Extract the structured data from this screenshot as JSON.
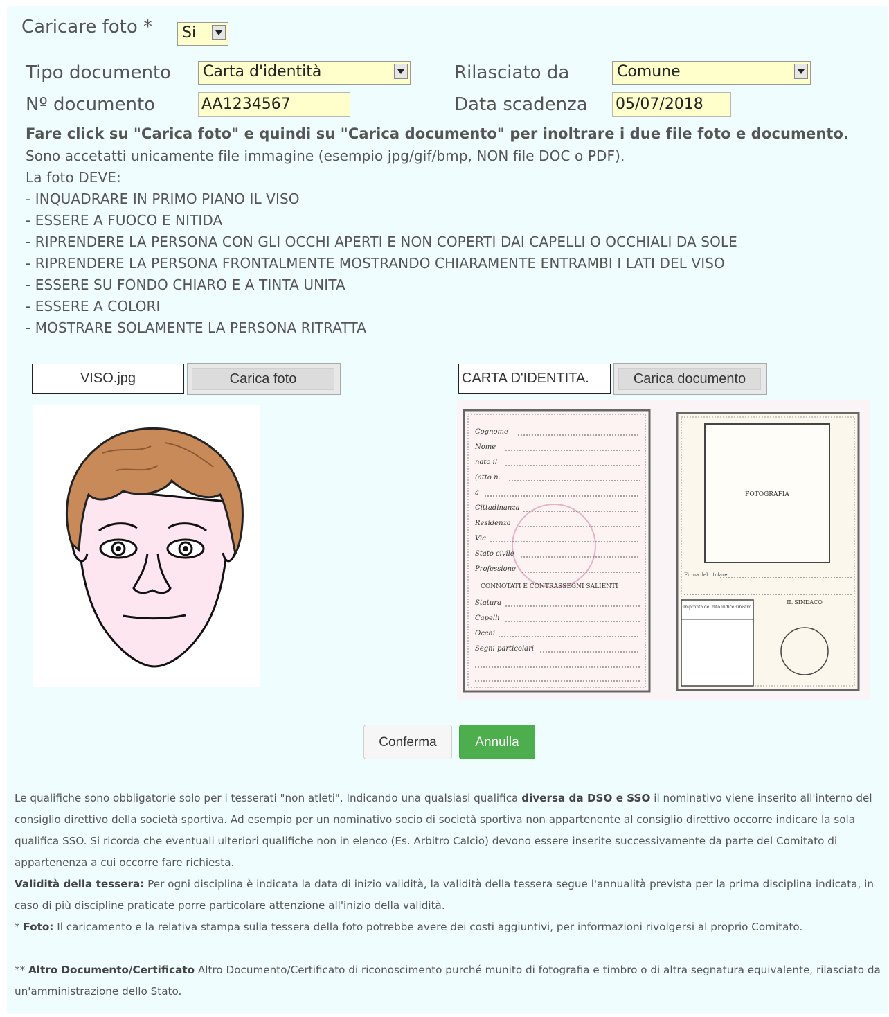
{
  "form": {
    "upload_photo_label": "Caricare foto *",
    "upload_photo_value": "Si",
    "doc_type_label": "Tipo documento",
    "doc_type_value": "Carta d'identità",
    "issued_by_label": "Rilasciato da",
    "issued_by_value": "Comune",
    "doc_number_label": "Nº documento",
    "doc_number_value": "AA1234567",
    "expiry_label": "Data scadenza",
    "expiry_value": "05/07/2018"
  },
  "instructions": {
    "bold_line": "Fare click su \"Carica foto\" e quindi su \"Carica documento\" per inoltrare i due file foto e documento.",
    "lines": [
      "Sono accetatti unicamente file immagine (esempio jpg/gif/bmp, NON file DOC o PDF).",
      "La foto DEVE:",
      "- INQUADRARE IN PRIMO PIANO IL VISO",
      "- ESSERE A FUOCO E NITIDA",
      "- RIPRENDERE LA PERSONA CON GLI OCCHI APERTI E NON COPERTI DAI CAPELLI O OCCHIALI DA SOLE",
      "- RIPRENDERE LA PERSONA FRONTALMENTE MOSTRANDO CHIARAMENTE ENTRAMBI I LATI DEL VISO",
      "- ESSERE SU FONDO CHIARO E A TINTA UNITA",
      "- ESSERE A COLORI",
      "- MOSTRARE SOLAMENTE LA PERSONA RITRATTA"
    ]
  },
  "upload": {
    "photo_file": "VISO.jpg",
    "photo_button": "Carica foto",
    "doc_file": "CARTA D'IDENTITA.",
    "doc_button": "Carica documento"
  },
  "id_card": {
    "fields": [
      "Cognome",
      "Nome",
      "nato il",
      "(atto n.",
      "a",
      "Cittadinanza",
      "Residenza",
      "Via",
      "Stato civile",
      "Professione"
    ],
    "section": "CONNOTATI E CONTRASSEGNI SALIENTI",
    "fields2": [
      "Statura",
      "Capelli",
      "Occhi",
      "Segni particolari"
    ],
    "photo_label": "FOTOGRAFIA",
    "signature_label": "Firma del titolare",
    "mayor_label": "IL SINDACO",
    "fingerprint_label": "Impronta del dito indice sinistro"
  },
  "actions": {
    "confirm": "Conferma",
    "cancel": "Annulla"
  },
  "footer": {
    "p1_a": "Le qualifiche sono obbligatorie solo per i tesserati \"non atleti\". Indicando una qualsiasi qualifica ",
    "p1_b": "diversa da DSO e SSO",
    "p1_c": " il nominativo viene inserito all'interno del consiglio direttivo della società sportiva. Ad esempio per un nominativo socio di società sportiva non appartenente al consiglio direttivo occorre indicare la sola qualifica SSO. Si ricorda che eventuali ulteriori qualifiche non in elenco (Es. Arbitro Calcio) devono essere inserite successivamente da parte del Comitato di appartenenza a cui occorre fare richiesta.",
    "p2_a": "Validità della tessera:",
    "p2_b": " Per ogni disciplina è indicata la data di inizio validità, la validità della tessera segue l'annualità prevista per la prima disciplina indicata, in caso di più discipline praticate porre particolare attenzione all'inizio della validità.",
    "p3_star": "* ",
    "p3_a": "Foto:",
    "p3_b": " Il caricamento e la relativa stampa sulla tessera della foto potrebbe avere dei costi aggiuntivi, per informazioni rivolgersi al proprio Comitato.",
    "p4_star": "** ",
    "p4_a": "Altro Documento/Certificato",
    "p4_b": " Altro Documento/Certificato di riconoscimento purché munito di fotografia e timbro o di altra segnatura equivalente, rilasciato da un'amministrazione dello Stato."
  },
  "colors": {
    "panel_bg": "#f0fdfe",
    "field_bg": "#ffffcc",
    "cancel_bg": "#4cae4c",
    "hair": "#c98a5a",
    "skin": "#fde6f0"
  }
}
